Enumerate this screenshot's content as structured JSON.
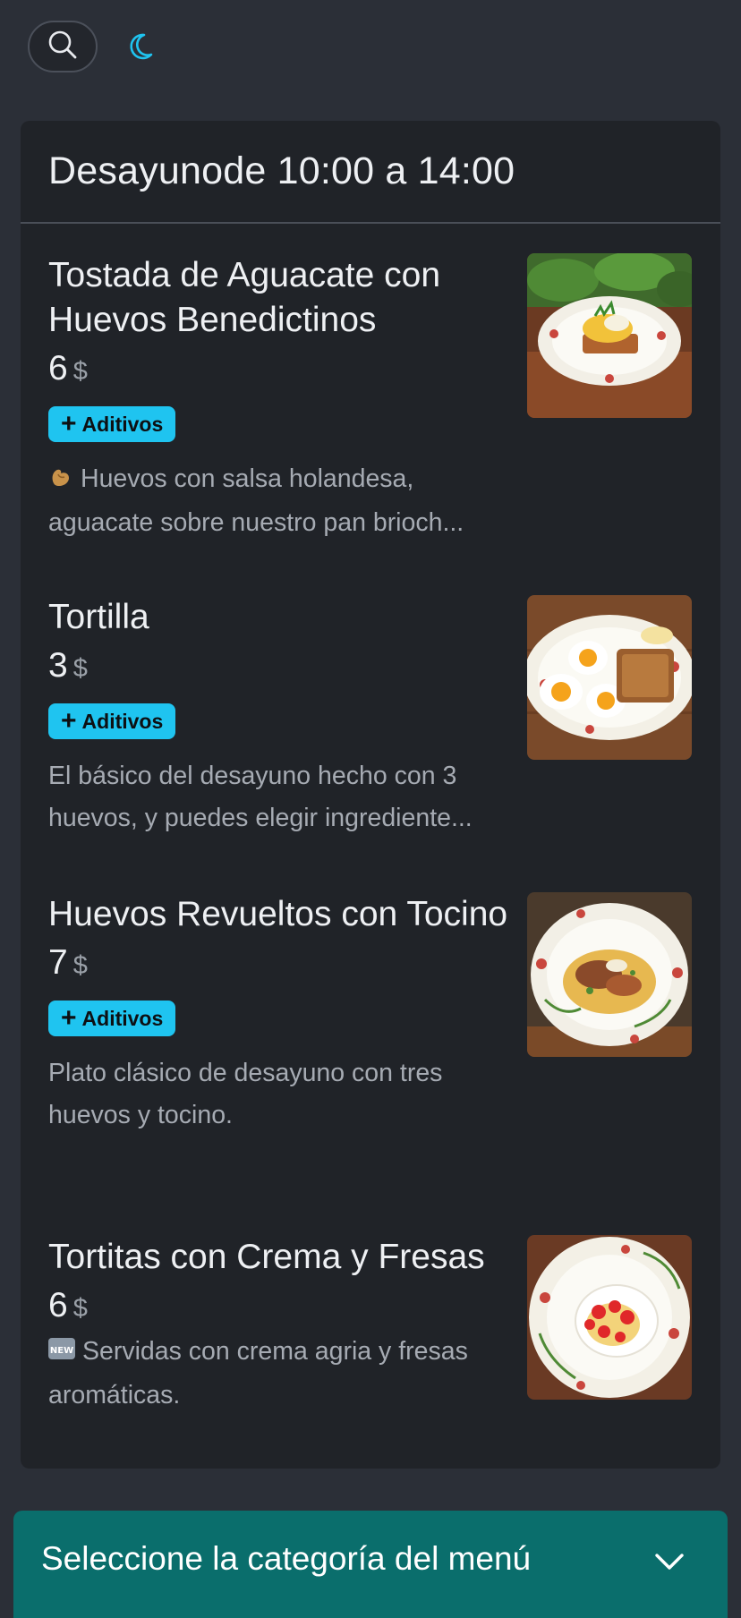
{
  "header": {
    "search_icon": "search-icon",
    "theme_icon": "moon-icon",
    "accent_color": "#1fc4f0"
  },
  "section": {
    "title": "Desayunode 10:00 a 14:00"
  },
  "items": [
    {
      "name": "Tostada de Aguacate con Huevos Benedictinos",
      "price": "6",
      "currency": "$",
      "addons_label": "Aditivos",
      "description": "Huevos con salsa holandesa, aguacate sobre nuestro pan brioch...",
      "badge_icon": "pinched-fingers-emoji"
    },
    {
      "name": "Tortilla",
      "price": "3",
      "currency": "$",
      "addons_label": "Aditivos",
      "description": "El básico del desayuno hecho con 3 huevos, y puedes elegir ingrediente..."
    },
    {
      "name": "Huevos Revueltos con Tocino",
      "price": "7",
      "currency": "$",
      "addons_label": "Aditivos",
      "description": "Plato clásico de desayuno con tres huevos y tocino."
    },
    {
      "name": "Tortitas con Crema y Fresas",
      "price": "6",
      "currency": "$",
      "description": "Servidas con crema agria y fresas aromáticas.",
      "badge_icon": "new-button-emoji",
      "badge_text": "NEW"
    }
  ],
  "category_selector": {
    "label": "Seleccione la categoría del menú",
    "icon": "chevron-down-icon",
    "color": "#0a6e6c"
  }
}
